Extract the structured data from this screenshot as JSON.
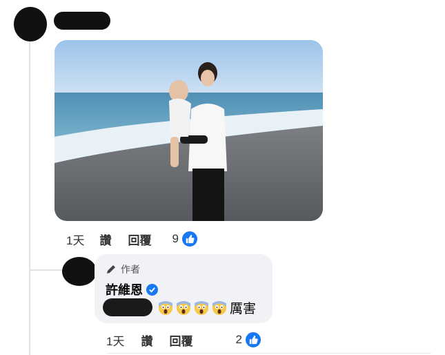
{
  "comment": {
    "timestamp": "1天",
    "like_label": "讚",
    "reply_label": "回覆",
    "like_count": "9"
  },
  "reply": {
    "author_badge": "作者",
    "author_name": "許維恩",
    "text": "厲害",
    "timestamp": "1天",
    "like_label": "讚",
    "reply_label": "回覆",
    "like_count": "2"
  },
  "colors": {
    "like_blue": "#1877f2",
    "bubble_bg": "#f0f2f5",
    "thread_line": "#dfe1e5"
  },
  "icons": [
    "pencil-icon",
    "verified-badge-icon",
    "like-thumb-icon",
    "screaming-face-emoji"
  ]
}
